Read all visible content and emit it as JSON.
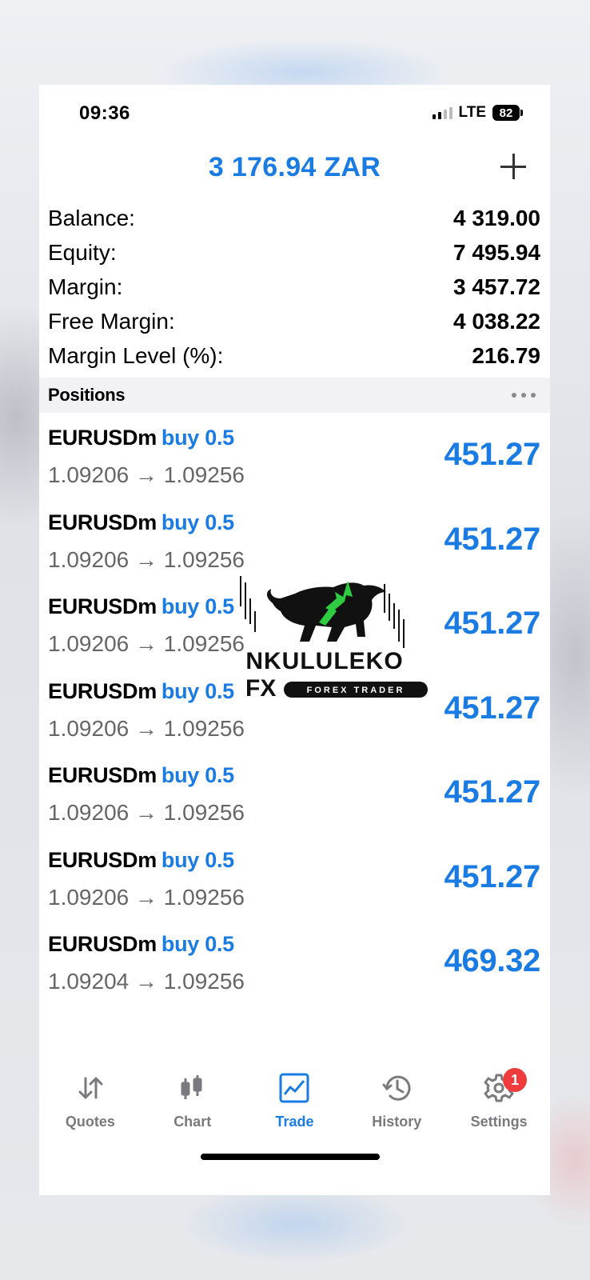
{
  "status_bar": {
    "time": "09:36",
    "network": "LTE",
    "battery": "82"
  },
  "header": {
    "title": "3 176.94 ZAR",
    "add_icon": "plus-icon"
  },
  "account": [
    {
      "label": "Balance:",
      "value": "4 319.00"
    },
    {
      "label": "Equity:",
      "value": "7 495.94"
    },
    {
      "label": "Margin:",
      "value": "3 457.72"
    },
    {
      "label": "Free Margin:",
      "value": "4 038.22"
    },
    {
      "label": "Margin Level (%):",
      "value": "216.79"
    }
  ],
  "positions_section": {
    "title": "Positions",
    "more_icon": "more-dots-icon"
  },
  "positions": [
    {
      "symbol": "EURUSDm",
      "type": "buy 0.5",
      "prices": "1.09206 → 1.09256",
      "profit": "451.27"
    },
    {
      "symbol": "EURUSDm",
      "type": "buy 0.5",
      "prices": "1.09206 → 1.09256",
      "profit": "451.27"
    },
    {
      "symbol": "EURUSDm",
      "type": "buy 0.5",
      "prices": "1.09206 → 1.09256",
      "profit": "451.27"
    },
    {
      "symbol": "EURUSDm",
      "type": "buy 0.5",
      "prices": "1.09206 → 1.09256",
      "profit": "451.27"
    },
    {
      "symbol": "EURUSDm",
      "type": "buy 0.5",
      "prices": "1.09206 → 1.09256",
      "profit": "451.27"
    },
    {
      "symbol": "EURUSDm",
      "type": "buy 0.5",
      "prices": "1.09206 → 1.09256",
      "profit": "451.27"
    },
    {
      "symbol": "EURUSDm",
      "type": "buy 0.5",
      "prices": "1.09204 → 1.09256",
      "profit": "469.32"
    }
  ],
  "watermark": {
    "line1": "NKULULEKO",
    "line2": "FX",
    "tagline": "FOREX TRADER"
  },
  "tabs": [
    {
      "label": "Quotes",
      "icon": "quotes-arrows-icon",
      "active": false
    },
    {
      "label": "Chart",
      "icon": "candlestick-icon",
      "active": false
    },
    {
      "label": "Trade",
      "icon": "trade-chart-icon",
      "active": true
    },
    {
      "label": "History",
      "icon": "history-clock-icon",
      "active": false
    },
    {
      "label": "Settings",
      "icon": "gear-icon",
      "active": false,
      "badge": "1"
    }
  ],
  "colors": {
    "accent": "#1a7be3",
    "badge": "#ee3b3b",
    "secondary_text": "#666666"
  }
}
